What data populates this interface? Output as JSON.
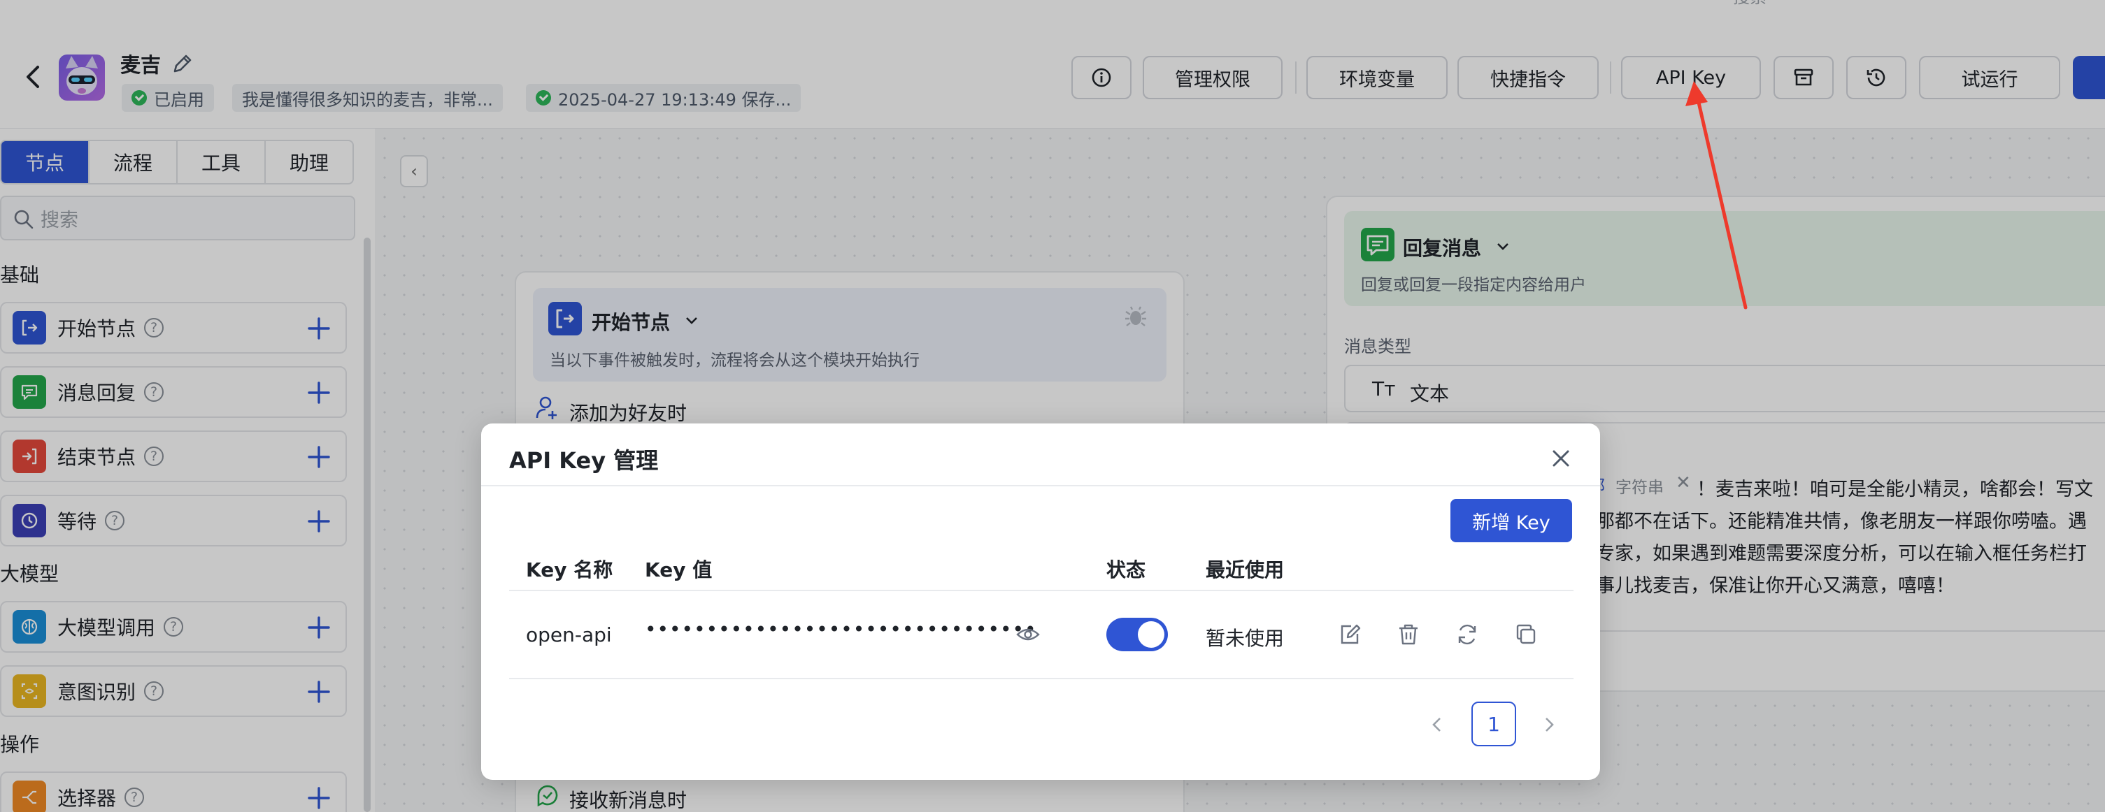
{
  "header": {
    "bot_name": "麦吉",
    "status_chip": "已启用",
    "description_chip": "我是懂得很多知识的麦吉，非常...",
    "saved_chip": "2025-04-27 19:13:49 保存...",
    "search_placeholder": "搜索",
    "buttons": {
      "permissions": "管理权限",
      "env_vars": "环境变量",
      "shortcuts": "快捷指令",
      "api_key": "API Key",
      "test_run": "试运行"
    }
  },
  "sidebar": {
    "tabs": [
      "节点",
      "流程",
      "工具",
      "助理"
    ],
    "search_placeholder": "搜索",
    "sections": {
      "basic": "基础",
      "llm": "大模型",
      "ops": "操作"
    },
    "items": [
      {
        "label": "开始节点"
      },
      {
        "label": "消息回复"
      },
      {
        "label": "结束节点"
      },
      {
        "label": "等待"
      },
      {
        "label": "大模型调用"
      },
      {
        "label": "意图识别"
      },
      {
        "label": "选择器"
      }
    ]
  },
  "canvas": {
    "start_node": {
      "title": "开始节点",
      "description": "当以下事件被触发时，流程将会从这个模块开始执行",
      "trigger_add_friend": "添加为好友时",
      "trigger_new_message": "接收新消息时"
    },
    "reply_node": {
      "title": "回复消息",
      "description": "回复或回复一段指定内容给用户",
      "message_type_label": "消息类型",
      "message_type_value": "文本",
      "message_type_icon": "Tт",
      "variable_tag": "部",
      "variable_type": "字符串",
      "body_lines": [
        "！麦吉来啦！咱可是全能小精灵，啥都会！写文",
        "那都不在话下。还能精准共情，像老朋友一样跟你唠嗑。遇",
        "专家，如果遇到难题需要深度分析，可以在输入框任务栏打",
        "事儿找麦吉，保准让你开心又满意，嘻嘻！"
      ]
    }
  },
  "modal": {
    "title": "API Key 管理",
    "new_key_label": "新增 Key",
    "columns": {
      "name": "Key 名称",
      "value": "Key 值",
      "status": "状态",
      "last_used": "最近使用"
    },
    "rows": [
      {
        "name": "open-api",
        "value_masked": "••••••••••••••••••••••••••••••••",
        "enabled": true,
        "last_used": "暂未使用"
      }
    ],
    "pagination": {
      "current_page": "1"
    }
  },
  "colors": {
    "primary": "#2f55d4",
    "success": "#2db75a",
    "reply_green": "#23a74b",
    "end_red": "#e5483c",
    "wait_indigo": "#3b3fb6",
    "llm_blue": "#1a8fd8",
    "intent_yellow": "#e9b722",
    "selector_orange": "#f08a24",
    "arrow_red": "#ee3a2c"
  }
}
